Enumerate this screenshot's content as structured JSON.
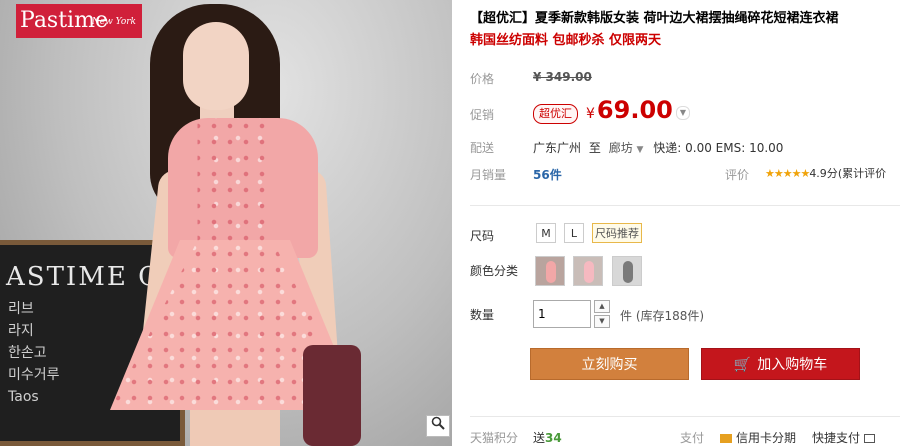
{
  "logo": {
    "brand": "Pastime",
    "tagline": "New York"
  },
  "photo": {
    "board_text": "ASTIME COFFE",
    "board_scribble": "리브\n라지\n한손고\n미수거루\nTaos",
    "zoom_icon": "magnifier-icon"
  },
  "product": {
    "title": "【超优汇】夏季新款韩版女装 荷叶边大裙摆抽绳碎花短裙连衣裙",
    "subtitle": "韩国丝纺面料 包邮秒杀 仅限两天"
  },
  "price": {
    "label": "价格",
    "original": "¥ 349.00"
  },
  "promo": {
    "label": "促销",
    "badge": "超优汇",
    "currency": "¥",
    "amount": "69.00",
    "chevron_icon": "chevron-down-icon"
  },
  "shipping": {
    "label": "配送",
    "from": "广东广州",
    "to_word": "至",
    "to": "廊坊",
    "fees": "快递: 0.00 EMS: 10.00"
  },
  "sales": {
    "label": "月销量",
    "value": "56件"
  },
  "rating": {
    "label": "评价",
    "stars": "★★★★★",
    "score": "4.9分",
    "cumulative": "(累计评价"
  },
  "size": {
    "label": "尺码",
    "options": [
      "M",
      "L"
    ],
    "recommend": "尺码推荐"
  },
  "color": {
    "label": "颜色分类"
  },
  "quantity": {
    "label": "数量",
    "value": "1",
    "stock": "件 (库存188件)",
    "up": "▲",
    "down": "▼"
  },
  "actions": {
    "buy_now": "立刻购买",
    "add_cart": "加入购物车",
    "cart_icon": "cart-icon"
  },
  "points": {
    "label": "天猫积分",
    "prefix": "送",
    "value": "34"
  },
  "payment": {
    "label": "支付",
    "credit": "信用卡分期",
    "quick": "快捷支付"
  },
  "colors": {
    "accent_red": "#c4161c",
    "buy_orange": "#d2803d",
    "price_red": "#cc0000",
    "link_blue": "#2a66a8"
  }
}
